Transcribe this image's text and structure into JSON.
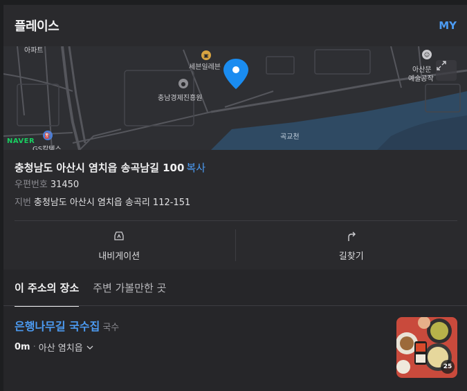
{
  "header": {
    "title": "플레이스",
    "my_label": "MY"
  },
  "map": {
    "labels": {
      "seven_eleven": "세븐일레븐",
      "chungnam": "충남경제진흥원",
      "asan": "아산문",
      "asan2": "예술공작",
      "gokgyo": "곡교천",
      "gs": "GS칼텍스",
      "top_left": "아파트"
    },
    "logo": "NAVER",
    "colors": {
      "land": "#2e2f33",
      "river": "#2f4a63",
      "road": "#55565c",
      "pin": "#1a8cf0"
    }
  },
  "address": {
    "road": "충청남도 아산시 염치읍 송곡남길 100",
    "copy_label": "복사",
    "postal_label": "우편번호",
    "postal_code": "31450",
    "jibun_label": "지번",
    "jibun": "충청남도 아산시 염치읍 송곡리 112-151"
  },
  "actions": {
    "navigation": {
      "label": "내비게이션",
      "icon": "car-navigation-icon"
    },
    "directions": {
      "label": "길찾기",
      "icon": "turn-arrow-icon"
    }
  },
  "tabs": [
    {
      "label": "이 주소의 장소",
      "active": true
    },
    {
      "label": "주변 가볼만한 곳",
      "active": false
    }
  ],
  "place": {
    "name": "은행나무길 국수집",
    "category": "국수",
    "distance": "0m",
    "area": "아산 염치읍",
    "photo_count": "25"
  }
}
